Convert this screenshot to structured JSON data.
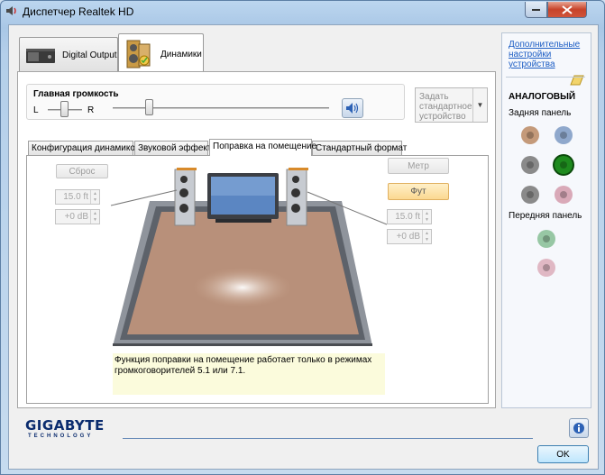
{
  "window": {
    "title": "Диспетчер Realtek HD"
  },
  "device_tabs": [
    {
      "label": "Digital Output",
      "active": false
    },
    {
      "label": "Динамики",
      "active": true
    }
  ],
  "volume": {
    "title": "Главная громкость",
    "left_label": "L",
    "right_label": "R",
    "balance_level": 0.5,
    "level": 0.17
  },
  "default_device": {
    "label": "Задать стандартное устройство"
  },
  "sub_tabs": [
    {
      "label": "Конфигурация динамиков",
      "active": false
    },
    {
      "label": "Звуковой эффект",
      "active": false
    },
    {
      "label": "Поправка на помещение",
      "active": true
    },
    {
      "label": "Стандартный формат",
      "active": false
    }
  ],
  "room_correction": {
    "reset_label": "Сброс",
    "meter_label": "Метр",
    "feet_label": "Фут",
    "left_distance": "15.0 ft",
    "left_gain": "+0 dB",
    "right_distance": "15.0 ft",
    "right_gain": "+0 dB",
    "note": "Функция поправки на помещение работает только в режимах громкоговорителей 5.1 или 7.1."
  },
  "sidebar": {
    "advanced_link": "Дополнительные настройки устройства",
    "analog_title": "АНАЛОГОВЫЙ",
    "back_panel": "Задняя панель",
    "front_panel": "Передняя панель"
  },
  "colors": {
    "accent_link": "#1b5cc4",
    "logo": "#0b2c6e",
    "jack_orange": "#c49a7a",
    "jack_blue": "#8fa8cc",
    "jack_gray": "#8a8a8a",
    "jack_green": "#1e8a1e",
    "jack_green_light": "#97c7a4",
    "jack_pink": "#d9a9b8",
    "jack_pink_light": "#e0b8c4"
  },
  "footer": {
    "brand": "GIGABYTE",
    "brand_sub": "TECHNOLOGY",
    "ok_label": "OK",
    "info_icon": "info-icon"
  }
}
